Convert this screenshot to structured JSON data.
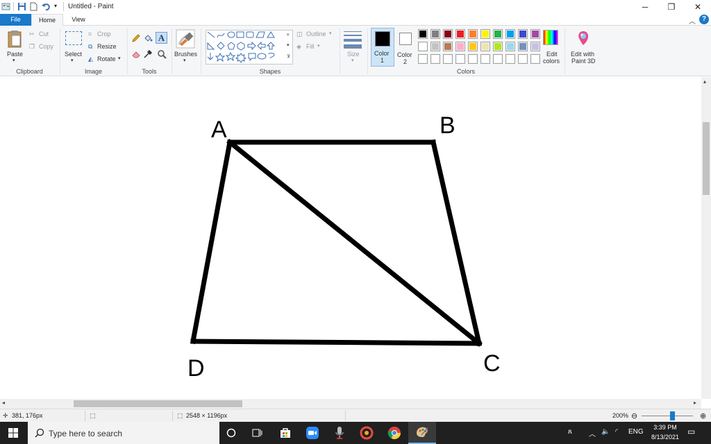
{
  "window": {
    "title": "Untitled - Paint",
    "minimize_glyph": "─",
    "maximize_glyph": "❐",
    "close_glyph": "✕"
  },
  "tabs": {
    "file": "File",
    "home": "Home",
    "view": "View",
    "help": "?"
  },
  "ribbon": {
    "clipboard": {
      "label": "Clipboard",
      "paste": "Paste",
      "cut": "Cut",
      "copy": "Copy"
    },
    "image": {
      "label": "Image",
      "select": "Select",
      "crop": "Crop",
      "resize": "Resize",
      "rotate": "Rotate"
    },
    "tools": {
      "label": "Tools"
    },
    "brushes": {
      "label": "Brushes"
    },
    "shapes": {
      "label": "Shapes",
      "outline": "Outline",
      "fill": "Fill"
    },
    "size": {
      "label": "Size"
    },
    "colors": {
      "label": "Colors",
      "color1": "Color",
      "color1_num": "1",
      "color2": "Color",
      "color2_num": "2",
      "edit_colors_1": "Edit",
      "edit_colors_2": "colors",
      "paint3d_1": "Edit with",
      "paint3d_2": "Paint 3D",
      "color1_value": "#000000",
      "color2_value": "#ffffff",
      "palette_row1": [
        "#000000",
        "#7f7f7f",
        "#880015",
        "#ed1c24",
        "#ff7f27",
        "#fff200",
        "#22b14c",
        "#00a2e8",
        "#3f48cc",
        "#a349a4"
      ],
      "palette_row2": [
        "#ffffff",
        "#c3c3c3",
        "#b97a57",
        "#ffaec9",
        "#ffc90e",
        "#efe4b0",
        "#b5e61d",
        "#99d9ea",
        "#7092be",
        "#c8bfe7"
      ],
      "palette_row3": [
        "#ffffff",
        "#ffffff",
        "#ffffff",
        "#ffffff",
        "#ffffff",
        "#ffffff",
        "#ffffff",
        "#ffffff",
        "#ffffff",
        "#ffffff"
      ]
    }
  },
  "canvas": {
    "label_a": "A",
    "label_b": "B",
    "label_c": "C",
    "label_d": "D"
  },
  "status": {
    "cursor_pos": "381, 176px",
    "image_size": "2548 × 1196px",
    "zoom": "200%"
  },
  "taskbar": {
    "search_placeholder": "Type here to search",
    "language": "ENG",
    "time": "3:39 PM",
    "date": "8/13/2021"
  }
}
